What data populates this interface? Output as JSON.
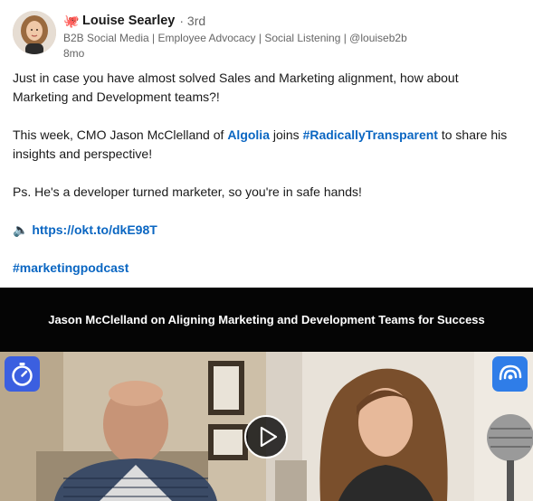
{
  "post": {
    "author": {
      "emoji": "🐙",
      "name": "Louise Searley",
      "degree": "· 3rd",
      "headline": "B2B Social Media | Employee Advocacy | Social Listening | @louiseb2b",
      "time": "8mo"
    },
    "body": {
      "line1": "Just in case you have almost solved Sales and Marketing alignment, how about",
      "line2": "Marketing and Development teams?!",
      "line3_prefix": "This week, CMO Jason McClelland of ",
      "line3_company": "Algolia",
      "line3_mid": " joins ",
      "line3_hashtag": "#RadicallyTransparent",
      "line3_suffix": " to share his",
      "line4": "insights and perspective!",
      "line5": "Ps. He's a developer turned marketer, so you're in safe hands!",
      "link_emoji": "🔈",
      "link": "https://okt.to/dkE98T",
      "hashtag": "#marketingpodcast"
    },
    "video": {
      "title": "Jason McClelland on Aligning Marketing and Development Teams for Success"
    }
  },
  "colors": {
    "link": "#0a66c2",
    "muted": "#666666",
    "badge_left": "#3b5fe0",
    "badge_right": "#2f7de8"
  },
  "icons": [
    "octopus-icon",
    "speaker-icon",
    "stopwatch-icon",
    "podcast-logo-icon",
    "play-icon"
  ]
}
